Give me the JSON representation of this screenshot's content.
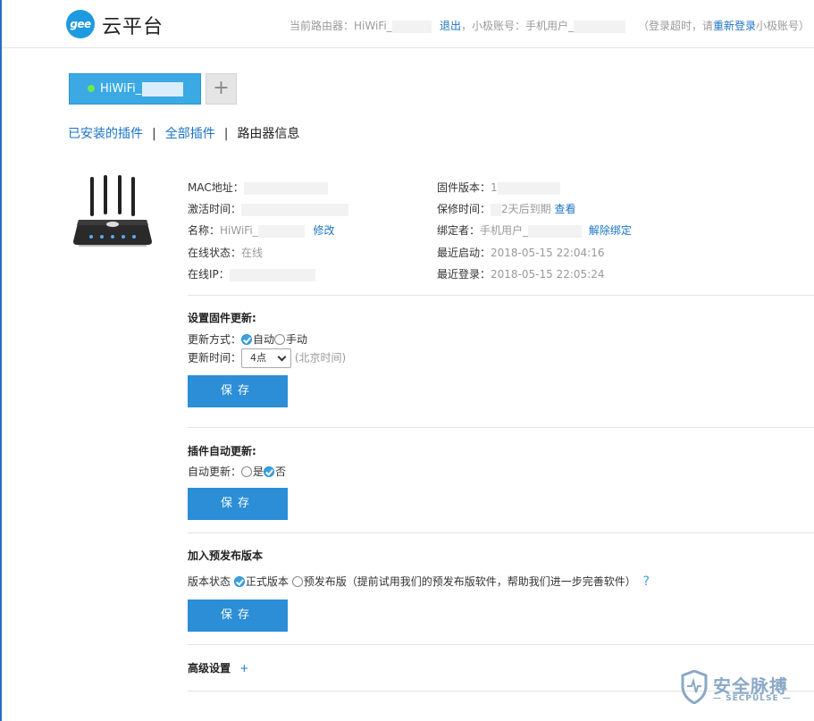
{
  "header": {
    "logo_mark": "gee",
    "logo_title": "云平台",
    "current_router_label": "当前路由器：HiWiFi_",
    "logout": "退出",
    "account_label": "，小极账号：手机用户_",
    "timeout_prefix": "（登录超时，请",
    "relogin": "重新登录",
    "timeout_suffix": "小极账号）"
  },
  "tabs": {
    "device_label": "HiWiFi_",
    "add_label": "+"
  },
  "subnav": {
    "installed": "已安装的插件",
    "all": "全部插件",
    "router_info": "路由器信息",
    "sep": "|"
  },
  "info": {
    "mac_label": "MAC地址：",
    "activate_label": "激活时间：",
    "name_label": "名称：",
    "name_value": "HiWiFi_",
    "name_edit": "修改",
    "status_label": "在线状态：",
    "status_value": "在线",
    "ip_label": "在线IP：",
    "fw_label": "固件版本：",
    "fw_value": "1",
    "warranty_label": "保修时间：",
    "warranty_value": "2天后到期",
    "warranty_view": "查看",
    "binder_label": "绑定者：",
    "binder_value": "手机用户_",
    "unbind": "解除绑定",
    "last_boot_label": "最近启动：",
    "last_boot_value": "2018-05-15 22:04:16",
    "last_login_label": "最近登录：",
    "last_login_value": "2018-05-15 22:05:24"
  },
  "firmware": {
    "title": "设置固件更新:",
    "mode_label": "更新方式：",
    "mode_auto": "自动",
    "mode_manual": "手动",
    "time_label": "更新时间：",
    "time_value": "4点",
    "time_note": "(北京时间)",
    "save": "保存"
  },
  "plugin": {
    "title": "插件自动更新:",
    "label": "自动更新：",
    "yes": "是",
    "no": "否",
    "save": "保存"
  },
  "prerelease": {
    "title": "加入预发布版本",
    "label": "版本状态",
    "official": "正式版本",
    "pre": "预发布版（提前试用我们的预发布版软件，帮助我们进一步完善软件）",
    "help": "?",
    "save": "保存"
  },
  "advanced": {
    "title": "高级设置",
    "toggle": "+"
  },
  "watermark": {
    "name": "安全脉搏",
    "sub": "— SECPULSE —"
  },
  "colors": {
    "accent": "#2b8ed6",
    "link": "#1a73c7",
    "tab": "#3aa9e4",
    "online_dot": "#6fe84d"
  }
}
